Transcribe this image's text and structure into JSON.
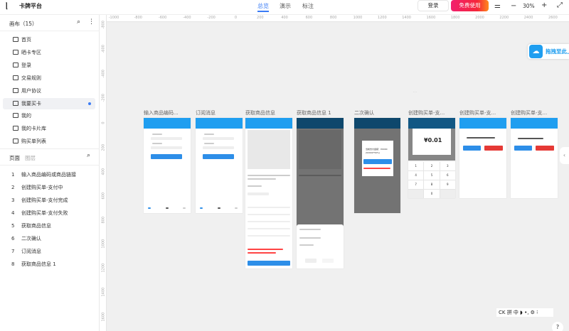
{
  "header": {
    "logo": "ᥣ",
    "brand": "卡牌平台",
    "tabs": [
      {
        "label": "总览",
        "active": true
      },
      {
        "label": "演示"
      },
      {
        "label": "标注"
      }
    ],
    "login": "登录",
    "free": "免费使用",
    "zoom": "30%",
    "zoom_out": "−",
    "zoom_in": "+"
  },
  "sidebar": {
    "canvas_title": "画布（15）",
    "items": [
      "首页",
      "晒卡专区",
      "登录",
      "交易规则",
      "用户协议",
      "我要买卡",
      "我的",
      "我的卡片库",
      "购买单列表"
    ],
    "selected": 5,
    "tabs": [
      "页面",
      "图层"
    ],
    "pages": [
      {
        "n": "1",
        "label": "输入商品编码或商品链接"
      },
      {
        "n": "2",
        "label": "创建购买单-支付中"
      },
      {
        "n": "3",
        "label": "创建购买单-支付完成"
      },
      {
        "n": "4",
        "label": "创建购买单-支付失败"
      },
      {
        "n": "5",
        "label": "获取商品信息"
      },
      {
        "n": "6",
        "label": "二次确认"
      },
      {
        "n": "7",
        "label": "订阅消息"
      },
      {
        "n": "8",
        "label": "获取商品信息 1"
      }
    ]
  },
  "rulers": {
    "h": [
      "-1000",
      "-800",
      "-600",
      "-400",
      "-200",
      "0",
      "200",
      "400",
      "600",
      "800",
      "1000",
      "1200",
      "1400",
      "1600",
      "1800",
      "2000",
      "2200",
      "2400",
      "2600"
    ],
    "v": [
      "-800",
      "-600",
      "-400",
      "-200",
      "0",
      "200",
      "400",
      "600",
      "800",
      "1000",
      "1200",
      "1400",
      "1600"
    ]
  },
  "frames": [
    {
      "title": "输入商品编码..."
    },
    {
      "title": "订阅消息"
    },
    {
      "title": "获取商品信息"
    },
    {
      "title": "获取商品信息 1"
    },
    {
      "title": "二次确认",
      "amount": "当前支付金额：¥9000",
      "amount2": "(¥2000*50%)"
    },
    {
      "title": "创建购买单-支...",
      "price": "¥0.01",
      "keys": [
        "1",
        "2",
        "3",
        "4",
        "5",
        "6",
        "7",
        "8",
        "9",
        "",
        "0",
        ""
      ]
    },
    {
      "title": "创建购买单-支..."
    },
    {
      "title": "创建购买单-支..."
    }
  ],
  "badge": {
    "label": "拖拽至此上"
  },
  "ime": {
    "text": "CK 拼 中 ◗ •, ⚙ ⁝"
  },
  "help": "?",
  "colors": {
    "accent": "#3b7cf5",
    "brand_blue": "#1f9ef0",
    "danger": "#e53935"
  }
}
